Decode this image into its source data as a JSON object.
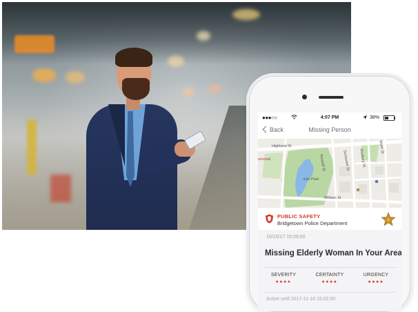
{
  "phone": {
    "status": {
      "signal": "●●●○○",
      "time": "4:07 PM",
      "battery_text": "38%",
      "battery_level": 0.38
    },
    "nav": {
      "back_label": "Back",
      "title": "Missing Person"
    },
    "map": {
      "labels": {
        "highland": "Highland St",
        "memorial": "emonal",
        "elm_park": "Elm Park",
        "russell": "Russell St",
        "somerset": "Somerset St",
        "roxbury": "Roxbury St",
        "river": "River St",
        "william": "William St"
      }
    },
    "alert": {
      "category": "PUBLIC SAFETY",
      "department": "Bridgetown Police Department",
      "timestamp": "10/15/17 15:09:00",
      "headline": "Missing Elderly Woman In Your Area",
      "metrics": [
        {
          "label": "SEVERITY",
          "dots": "●●●●"
        },
        {
          "label": "CERTAINTY",
          "dots": "●●●●"
        },
        {
          "label": "URGENCY",
          "dots": "●●●●"
        }
      ],
      "active_until": "Active until 2017-11-16 15:02:00"
    },
    "colors": {
      "accent_red": "#d23a2e",
      "star_gold": "#c8912d"
    }
  }
}
